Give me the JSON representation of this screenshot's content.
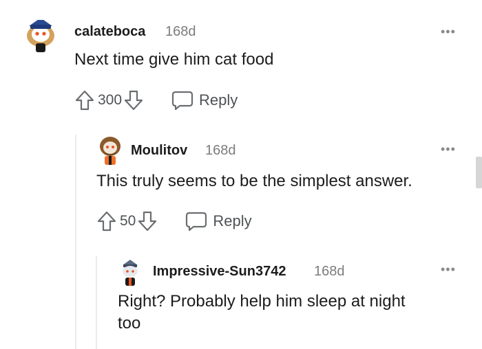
{
  "comments": [
    {
      "username": "calateboca",
      "age": "168d",
      "text": "Next time give him cat food",
      "votes": "300",
      "reply_label": "Reply",
      "more": "•••"
    },
    {
      "username": "Moulitov",
      "age": "168d",
      "text": "This truly seems to be the simplest answer.",
      "votes": "50",
      "reply_label": "Reply",
      "more": "•••"
    },
    {
      "username": "Impressive-Sun3742",
      "age": "168d",
      "text_line1": "Right? Probably help him sleep at night",
      "text_line2": "too",
      "more": "•••"
    }
  ],
  "icons": {
    "upvote": "upvote-arrow-icon",
    "downvote": "downvote-arrow-icon",
    "reply": "speech-bubble-icon",
    "more": "more-options-icon"
  },
  "colors": {
    "text": "#1c1c1c",
    "muted": "#7c7c7c",
    "action": "#4f5254",
    "thread_line": "#e9ebec"
  }
}
